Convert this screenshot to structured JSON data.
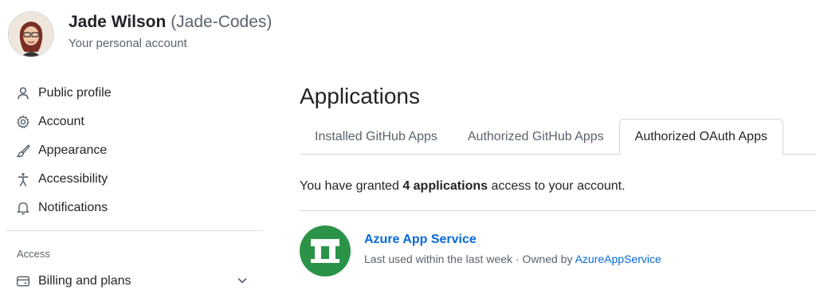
{
  "user": {
    "name": "Jade Wilson",
    "login": "(Jade-Codes)",
    "subtitle": "Your personal account"
  },
  "sidebar": {
    "items": [
      {
        "label": "Public profile",
        "icon": "person-icon"
      },
      {
        "label": "Account",
        "icon": "gear-icon"
      },
      {
        "label": "Appearance",
        "icon": "paintbrush-icon"
      },
      {
        "label": "Accessibility",
        "icon": "accessibility-icon"
      },
      {
        "label": "Notifications",
        "icon": "bell-icon"
      }
    ],
    "section_label": "Access",
    "billing": {
      "label": "Billing and plans",
      "icon": "credit-card-icon"
    }
  },
  "main": {
    "title": "Applications",
    "tabs": [
      {
        "label": "Installed GitHub Apps",
        "active": false
      },
      {
        "label": "Authorized GitHub Apps",
        "active": false
      },
      {
        "label": "Authorized OAuth Apps",
        "active": true
      }
    ],
    "granted": {
      "prefix": "You have granted",
      "count_text": "4 applications",
      "suffix": "access to your account."
    },
    "apps": [
      {
        "name": "Azure App Service",
        "meta_prefix": "Last used within the last week · Owned by",
        "owner": "AzureAppService",
        "logo_color": "#2b9348"
      }
    ]
  },
  "colors": {
    "link": "#0969da",
    "muted": "#59636e",
    "border": "#d0d7de"
  }
}
